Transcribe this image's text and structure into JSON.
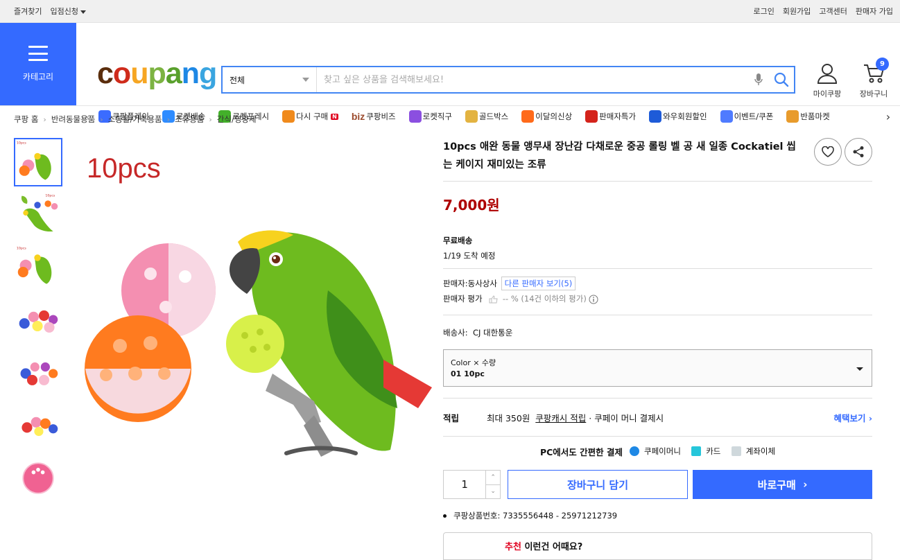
{
  "topbar": {
    "left": [
      "즐겨찾기",
      "입점신청"
    ],
    "right": [
      "로그인",
      "회원가입",
      "고객센터",
      "판매자 가입"
    ]
  },
  "header": {
    "category_label": "카테고리",
    "logo": {
      "letters": [
        "c",
        "o",
        "u",
        "p",
        "a",
        "n",
        "g"
      ],
      "colors": [
        "#5a2d0c",
        "#cf2b1b",
        "#f6a623",
        "#7cb342",
        "#59a02c",
        "#1e88e5",
        "#3aa5e0"
      ]
    },
    "search": {
      "category": "전체",
      "placeholder": "찾고 싶은 상품을 검색해보세요!"
    },
    "mycoupang": "마이쿠팡",
    "cart": "장바구니",
    "cart_count": "9"
  },
  "nav": [
    {
      "label": "쿠팡플레이",
      "icon": "play-icon",
      "color": "#3b6cff"
    },
    {
      "label": "로켓배송",
      "icon": "rocket-icon",
      "color": "#2f8cff"
    },
    {
      "label": "로켓프레시",
      "icon": "rocket-fresh-icon",
      "color": "#43b02a"
    },
    {
      "label": "다시 구매",
      "icon": "basket-icon",
      "color": "#f08a1c",
      "badge": "N"
    },
    {
      "label": "쿠팡비즈",
      "icon": "biz-icon",
      "color": "#9b4a2c",
      "prefix": "biz"
    },
    {
      "label": "로켓직구",
      "icon": "rocket-global-icon",
      "color": "#8b4fe0"
    },
    {
      "label": "골드박스",
      "icon": "goldbox-icon",
      "color": "#e3b341"
    },
    {
      "label": "이달의신상",
      "icon": "new-bag-icon",
      "color": "#ff6a1a"
    },
    {
      "label": "판매자특가",
      "icon": "percent-badge-icon",
      "color": "#d4231b"
    },
    {
      "label": "와우회원할인",
      "icon": "wow-icon",
      "color": "#1e5bd8"
    },
    {
      "label": "이벤트/쿠폰",
      "icon": "coupon-icon",
      "color": "#4f7bff"
    },
    {
      "label": "반품마켓",
      "icon": "market-icon",
      "color": "#e89b2c"
    }
  ],
  "breadcrumb": [
    "쿠팡 홈",
    "반려동물용품",
    "소동물/가축용품",
    "조류용품",
    "간식/영양제"
  ],
  "gallery": {
    "main_caption": "10pcs",
    "thumb_captions": [
      "10pcs",
      "10pcs",
      "10pcs",
      "",
      "",
      "",
      ""
    ]
  },
  "product": {
    "title": "10pcs 애완 동물 앵무새 장난감 다채로운 중공 롤링 벨 공 새 일종 Cockatiel 씹는 케이지 재미있는 조류",
    "price": "7,000원",
    "shipping_title": "무료배송",
    "arrival": "1/19 도착 예정",
    "seller_label": "판매자:",
    "seller": "동사상사",
    "other_sellers": "다른 판매자 보기(5)",
    "rating_label": "판매자 평가",
    "rating_value": "-- %",
    "rating_note": "(14건 이하의 평가)",
    "carrier_label": "배송사:",
    "carrier": "CJ 대한통운",
    "option_label": "Color × 수량",
    "option_value": "01 10pc",
    "reward_label": "적립",
    "reward_text": "최대 350원",
    "reward_link": "쿠팡캐시 적립",
    "reward_suffix": "· 쿠페이 머니 결제시",
    "reward_more": "혜택보기",
    "pay_title": "PC에서도 간편한 결제",
    "pay_methods": [
      "쿠페이머니",
      "카드",
      "계좌이체"
    ],
    "quantity": "1",
    "cart_button": "장바구니 담기",
    "buy_button": "바로구매",
    "product_id": "쿠팡상품번호: 7335556448 - 25971212739",
    "reco_red": "추천",
    "reco_text": "이런건 어때요?"
  }
}
